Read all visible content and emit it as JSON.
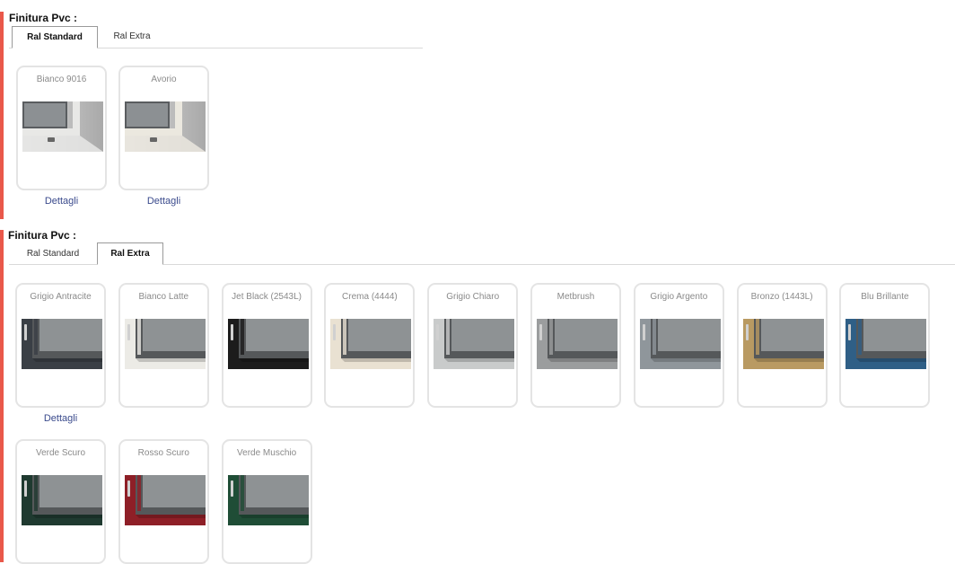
{
  "section1": {
    "title": "Finitura Pvc :",
    "tabs": [
      "Ral Standard",
      "Ral Extra"
    ],
    "active_tab": "Ral Standard",
    "cards": [
      {
        "name": "Bianco 9016",
        "frame": "#e8e8e6",
        "details": "Dettagli"
      },
      {
        "name": "Avorio",
        "frame": "#ebe8df",
        "details": "Dettagli"
      }
    ]
  },
  "section2": {
    "title": "Finitura Pvc :",
    "tabs": [
      "Ral Standard",
      "Ral Extra"
    ],
    "active_tab": "Ral Extra",
    "cards": [
      {
        "name": "Grigio Antracite",
        "frame": "#3a3f45",
        "details": "Dettagli"
      },
      {
        "name": "Bianco Latte",
        "frame": "#ecebe6"
      },
      {
        "name": "Jet Black (2543L)",
        "frame": "#1c1c1c"
      },
      {
        "name": "Crema (4444)",
        "frame": "#e9e1d2"
      },
      {
        "name": "Grigio Chiaro",
        "frame": "#c9cbcb"
      },
      {
        "name": "Metbrush",
        "frame": "#9b9d9e"
      },
      {
        "name": "Grigio Argento",
        "frame": "#8f969b"
      },
      {
        "name": "Bronzo (1443L)",
        "frame": "#b99a62"
      },
      {
        "name": "Blu Brillante",
        "frame": "#2f5f86"
      },
      {
        "name": "Verde Scuro",
        "frame": "#1f3a30"
      },
      {
        "name": "Rosso Scuro",
        "frame": "#8e1f27"
      },
      {
        "name": "Verde Muschio",
        "frame": "#1f4d36"
      }
    ]
  }
}
